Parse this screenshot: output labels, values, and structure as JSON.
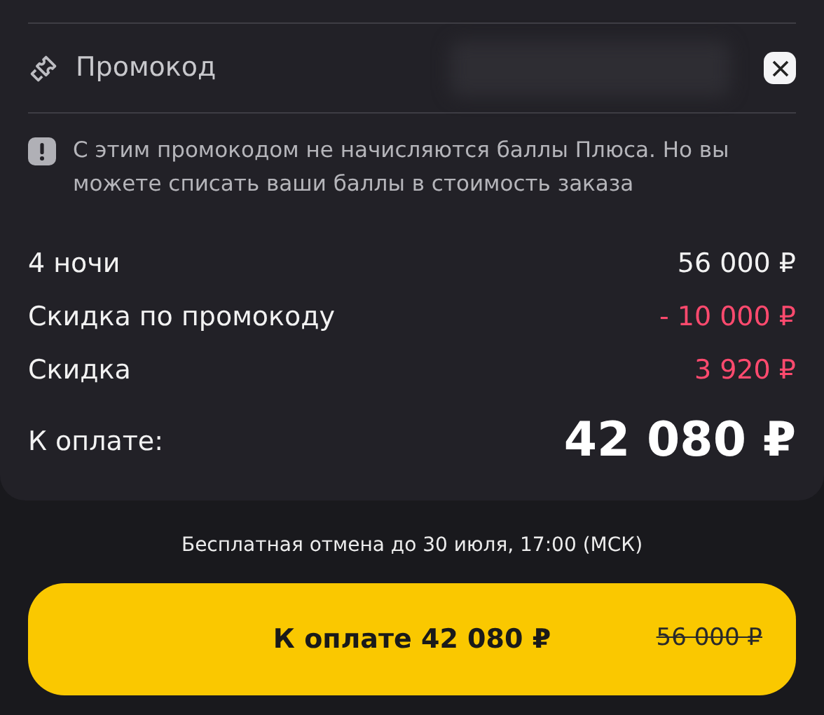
{
  "promo": {
    "label": "Промокод"
  },
  "notice": "С этим промокодом не начисляются баллы Плюса. Но вы можете списать ваши баллы в стоимость заказа",
  "lines": [
    {
      "label": "4 ночи",
      "amount": "56 000 ₽",
      "kind": "normal"
    },
    {
      "label": "Скидка по промокоду",
      "amount": "- 10 000 ₽",
      "kind": "discount"
    },
    {
      "label": "Скидка",
      "amount": "3 920 ₽",
      "kind": "discount"
    }
  ],
  "total": {
    "label": "К оплате:",
    "amount": "42 080 ₽"
  },
  "cancellation": "Бесплатная отмена до 30 июля, 17:00 (МСК)",
  "pay_button": {
    "label": "К оплате 42 080 ₽",
    "old_price": "56 000 ₽"
  }
}
